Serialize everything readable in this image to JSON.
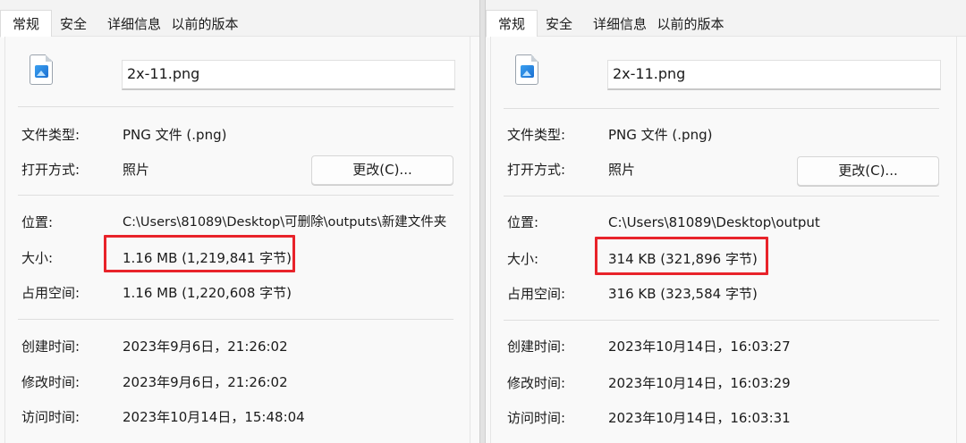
{
  "left": {
    "tabs": [
      "常规",
      "安全",
      "详细信息",
      "以前的版本"
    ],
    "file_name": "2x-11.png",
    "file_type_label": "文件类型:",
    "file_type_value": "PNG 文件 (.png)",
    "open_with_label": "打开方式:",
    "open_with_value": "照片",
    "change_button": "更改(C)...",
    "location_label": "位置:",
    "location_value": "C:\\Users\\81089\\Desktop\\可删除\\outputs\\新建文件夹",
    "size_label": "大小:",
    "size_value": "1.16 MB (1,219,841 字节)",
    "size_on_disk_label": "占用空间:",
    "size_on_disk_value": "1.16 MB (1,220,608 字节)",
    "created_label": "创建时间:",
    "created_value": "2023年9月6日，21:26:02",
    "modified_label": "修改时间:",
    "modified_value": "2023年9月6日，21:26:02",
    "accessed_label": "访问时间:",
    "accessed_value": "2023年10月14日，15:48:04"
  },
  "right": {
    "tabs": [
      "常规",
      "安全",
      "详细信息",
      "以前的版本"
    ],
    "file_name": "2x-11.png",
    "file_type_label": "文件类型:",
    "file_type_value": "PNG 文件 (.png)",
    "open_with_label": "打开方式:",
    "open_with_value": "照片",
    "change_button": "更改(C)...",
    "location_label": "位置:",
    "location_value": "C:\\Users\\81089\\Desktop\\output",
    "size_label": "大小:",
    "size_value": "314 KB (321,896 字节)",
    "size_on_disk_label": "占用空间:",
    "size_on_disk_value": "316 KB (323,584 字节)",
    "created_label": "创建时间:",
    "created_value": "2023年10月14日，16:03:27",
    "modified_label": "修改时间:",
    "modified_value": "2023年10月14日，16:03:29",
    "accessed_label": "访问时间:",
    "accessed_value": "2023年10月14日，16:03:31"
  },
  "icons": {
    "file": "png-image-file-icon"
  },
  "colors": {
    "highlight": "#e8232a",
    "panel_background": "#f9f9f9"
  }
}
